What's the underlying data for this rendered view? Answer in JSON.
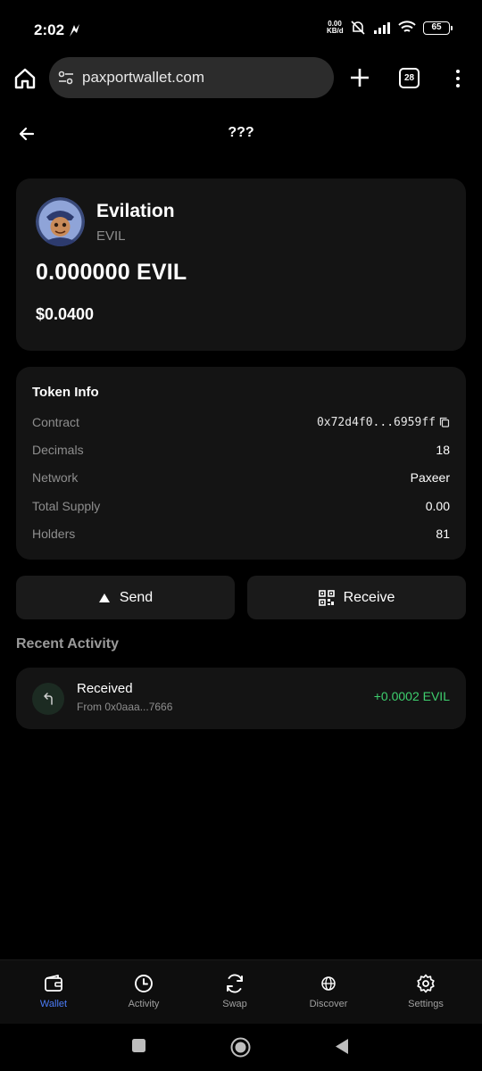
{
  "status_bar": {
    "time": "2:02",
    "net_speed": "0.00",
    "net_unit": "KB/d",
    "battery": "65"
  },
  "browser": {
    "url": "paxportwallet.com",
    "tab_count": "28"
  },
  "header": {
    "title": "???"
  },
  "token": {
    "name": "Evilation",
    "symbol": "EVIL",
    "balance": "0.000000 EVIL",
    "usd_value": "$0.0400"
  },
  "token_info": {
    "title": "Token Info",
    "rows": [
      {
        "label": "Contract",
        "value": "0x72d4f0...6959ff"
      },
      {
        "label": "Decimals",
        "value": "18"
      },
      {
        "label": "Network",
        "value": "Paxeer"
      },
      {
        "label": "Total Supply",
        "value": "0.00"
      },
      {
        "label": "Holders",
        "value": "81"
      }
    ]
  },
  "actions": {
    "send_label": "Send",
    "receive_label": "Receive"
  },
  "recent_activity": {
    "title": "Recent Activity",
    "items": [
      {
        "type": "Received",
        "from": "From 0x0aaa...7666",
        "amount": "+0.0002 EVIL"
      }
    ]
  },
  "bottom_nav": {
    "items": [
      {
        "label": "Wallet",
        "icon": "wallet-icon",
        "active": true
      },
      {
        "label": "Activity",
        "icon": "clock-icon",
        "active": false
      },
      {
        "label": "Swap",
        "icon": "swap-icon",
        "active": false
      },
      {
        "label": "Discover",
        "icon": "globe-icon",
        "active": false
      },
      {
        "label": "Settings",
        "icon": "gear-icon",
        "active": false
      }
    ]
  },
  "colors": {
    "accent": "#4b7cf7",
    "positive": "#3ecf6e",
    "card": "#141414",
    "background": "#000000"
  }
}
